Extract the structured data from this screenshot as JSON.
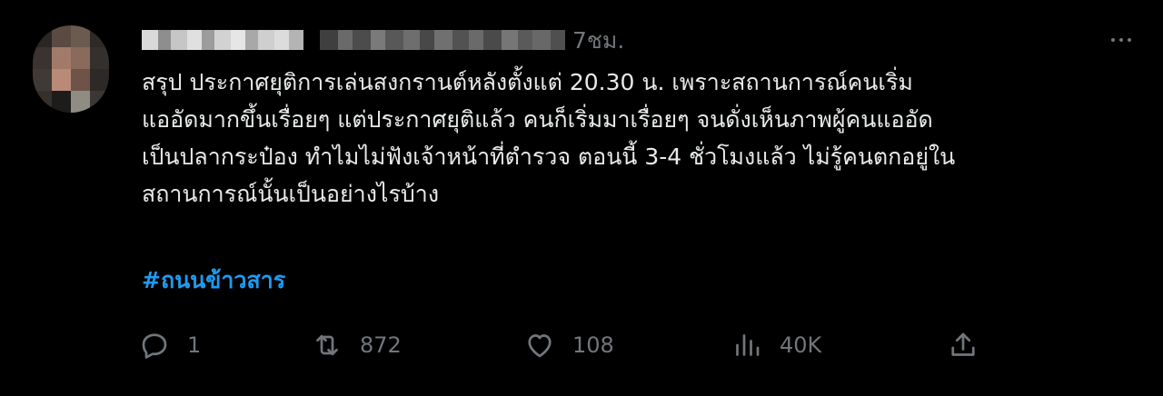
{
  "tweet": {
    "time": "7ชม.",
    "text_lines": [
      "สรุป ประกาศยุติการเล่นสงกรานต์หลังตั้งแต่ 20.30 น. เพราะสถานการณ์คนเริ่ม",
      "แออัดมากขึ้นเรื่อยๆ แต่ประกาศยุติแล้ว คนก็เริ่มมาเรื่อยๆ จนดั่งเห็นภาพผู้คนแออัด",
      "เป็นปลากระป๋อง ทำไมไม่ฟังเจ้าหน้าที่ตำรวจ ตอนนี้ 3-4 ชั่วโมงแล้ว ไม่รู้คนตกอยู่ใน",
      "สถานการณ์นั้นเป็นอย่างไรบ้าง"
    ],
    "hashtag": "#ถนนข้าวสาร"
  },
  "actions": {
    "reply_count": "1",
    "retweet_count": "872",
    "like_count": "108",
    "view_count": "40K"
  },
  "colors": {
    "background": "#000000",
    "text": "#e7e9ea",
    "muted": "#71767b",
    "link": "#1d9bf0"
  },
  "icons": [
    "more-icon",
    "reply-icon",
    "retweet-icon",
    "like-icon",
    "views-icon",
    "share-icon"
  ]
}
